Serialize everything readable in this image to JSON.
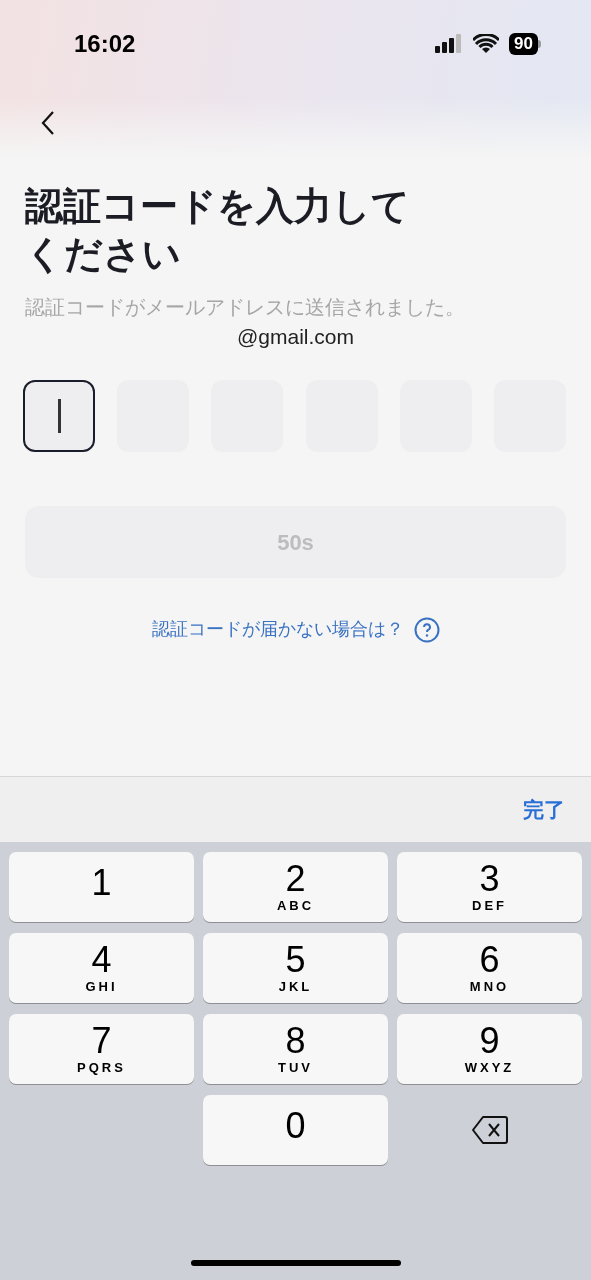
{
  "status_bar": {
    "time": "16:02",
    "battery": "90"
  },
  "title": "認証コードを入力してください",
  "subtitle": "認証コードがメールアドレスに送信されました。",
  "email": "@gmail.com",
  "code_cells": [
    {
      "selected": true
    },
    {
      "selected": false
    },
    {
      "selected": false
    },
    {
      "selected": false
    },
    {
      "selected": false
    },
    {
      "selected": false
    }
  ],
  "resend_button": {
    "label": "50s",
    "disabled": true
  },
  "help_link": "認証コードが届かない場合は？",
  "keyboard_toolbar": {
    "done": "完了"
  },
  "keys": [
    {
      "kind": "digit",
      "digit": "1"
    },
    {
      "kind": "digit",
      "digit": "2",
      "letters": "ABC"
    },
    {
      "kind": "digit",
      "digit": "3",
      "letters": "DEF"
    },
    {
      "kind": "digit",
      "digit": "4",
      "letters": "GHI"
    },
    {
      "kind": "digit",
      "digit": "5",
      "letters": "JKL"
    },
    {
      "kind": "digit",
      "digit": "6",
      "letters": "MNO"
    },
    {
      "kind": "digit",
      "digit": "7",
      "letters": "PQRS"
    },
    {
      "kind": "digit",
      "digit": "8",
      "letters": "TUV"
    },
    {
      "kind": "digit",
      "digit": "9",
      "letters": "WXYZ"
    },
    {
      "kind": "digit",
      "digit": "0"
    },
    {
      "kind": "delete"
    }
  ]
}
